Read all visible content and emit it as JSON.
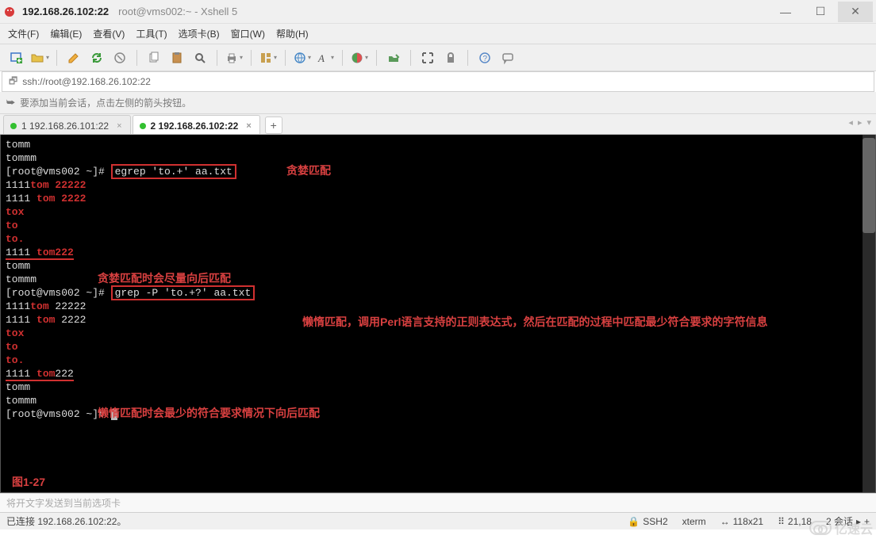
{
  "titlebar": {
    "main": "192.168.26.102:22",
    "sub": "root@vms002:~ - Xshell 5"
  },
  "menu": {
    "file": "文件(F)",
    "edit": "编辑(E)",
    "view": "查看(V)",
    "tools": "工具(T)",
    "tabs": "选项卡(B)",
    "window": "窗口(W)",
    "help": "帮助(H)"
  },
  "address": {
    "url": "ssh://root@192.168.26.102:22"
  },
  "hint": {
    "text": "要添加当前会话，点击左侧的箭头按钮。"
  },
  "tabs": {
    "t1": {
      "label": "1 192.168.26.101:22"
    },
    "t2": {
      "label": "2 192.168.26.102:22"
    }
  },
  "terminal": {
    "l1": "tomm",
    "l2": "tommm",
    "prompt1": "[root@vms002 ~]# ",
    "cmd1": "egrep 'to.+' aa.txt",
    "annot1": "贪婪匹配",
    "l4a": "1111",
    "l4b": "tom 22222",
    "l5a": "1111 ",
    "l5b": "tom 2222",
    "l6": "tox",
    "l7": "to",
    "l8": "to.",
    "l9a": "1111 ",
    "l9b": "tom222",
    "annot2": "贪婪匹配时会尽量向后匹配",
    "l10": "tomm",
    "l11": "tommm",
    "prompt2": "[root@vms002 ~]# ",
    "cmd2": "grep -P 'to.+?' aa.txt",
    "annot3": "懒惰匹配，调用Perl语言支持的正则表达式，然后在匹配的过程中匹配最少符合要求的字符信息",
    "l13a": "1111",
    "l13b": "tom",
    "l13c": " 22222",
    "l14a": "1111 ",
    "l14b": "tom",
    "l14c": " 2222",
    "l15": "tox",
    "l16": "to",
    "l17": "to.",
    "l18a": "1111 ",
    "l18b": "tom",
    "l18c": "222",
    "annot4": "懒惰匹配时会最少的符合要求情况下向后匹配",
    "l19": "tomm",
    "l20": "tommm",
    "prompt3": "[root@vms002 ~]# ",
    "figlabel": "图1-27"
  },
  "inputbar": {
    "placeholder": "将开文字发送到当前选项卡"
  },
  "status": {
    "conn": "已连接 192.168.26.102:22。",
    "proto": "SSH2",
    "term": "xterm",
    "size": "118x21",
    "pos": "21,18",
    "sessions": "2 会话"
  },
  "watermark": "亿速云",
  "icons": {
    "app": "🪲",
    "lock": "🔒",
    "arrowhint": "➦",
    "ssh_lock": "🔒",
    "uparrows": "↕"
  }
}
